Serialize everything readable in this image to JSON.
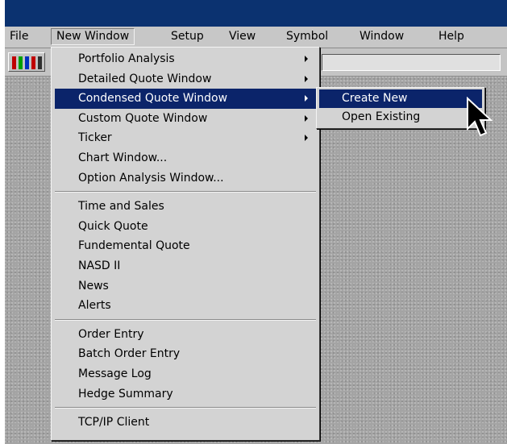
{
  "menubar": {
    "items": [
      "File",
      "New Window",
      "Setup",
      "View",
      "Symbol",
      "Window",
      "Help"
    ],
    "active_index": 1
  },
  "new_window_menu": {
    "groups": [
      [
        {
          "label": "Portfolio Analysis",
          "submenu": true
        },
        {
          "label": "Detailed Quote Window",
          "submenu": true
        },
        {
          "label": "Condensed Quote Window",
          "submenu": true,
          "highlighted": true
        },
        {
          "label": "Custom Quote Window",
          "submenu": true
        },
        {
          "label": "Ticker",
          "submenu": true
        },
        {
          "label": "Chart Window..."
        },
        {
          "label": "Option Analysis Window..."
        }
      ],
      [
        {
          "label": "Time and Sales"
        },
        {
          "label": "Quick Quote"
        },
        {
          "label": "Fundemental Quote"
        },
        {
          "label": "NASD II"
        },
        {
          "label": "News"
        },
        {
          "label": "Alerts"
        }
      ],
      [
        {
          "label": "Order Entry"
        },
        {
          "label": "Batch Order Entry"
        },
        {
          "label": "Message Log"
        },
        {
          "label": "Hedge Summary"
        }
      ],
      [
        {
          "label": "TCP/IP Client"
        }
      ]
    ]
  },
  "submenu": {
    "items": [
      {
        "label": "Create New",
        "highlighted": true
      },
      {
        "label": "Open Existing"
      }
    ]
  },
  "colors": {
    "titlebar": "#0b3270",
    "highlight": "#0b246a",
    "menu_bg": "#d3d3d3"
  },
  "icons": {
    "toolbar_icon": "portfolio-bars-icon",
    "cursor": "mouse-pointer-icon"
  }
}
